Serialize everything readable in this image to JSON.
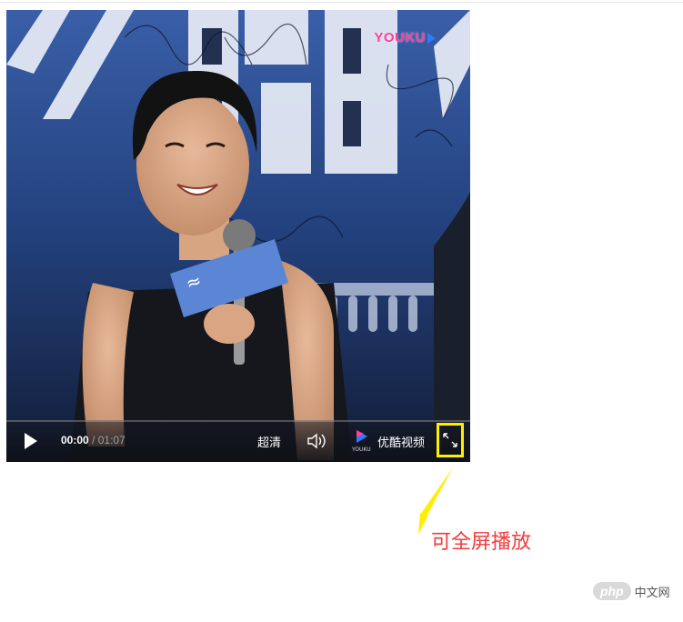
{
  "player": {
    "logo_text": "YOUKU",
    "controls": {
      "current_time": "00:00",
      "time_separator": "/",
      "total_time": "01:07",
      "quality_label": "超清",
      "brand_mini": "YOUKU",
      "brand_label": "优酷视频"
    },
    "icons": {
      "play": "play-icon",
      "volume": "volume-icon",
      "fullscreen": "fullscreen-icon",
      "brand": "youku-logo-icon"
    },
    "highlight_color": "#ffee00"
  },
  "annotation": {
    "text": "可全屏播放",
    "color": "#f03c3c",
    "arrow_color": "#ffee00"
  },
  "watermark": {
    "badge": "php",
    "label": "中文网"
  }
}
